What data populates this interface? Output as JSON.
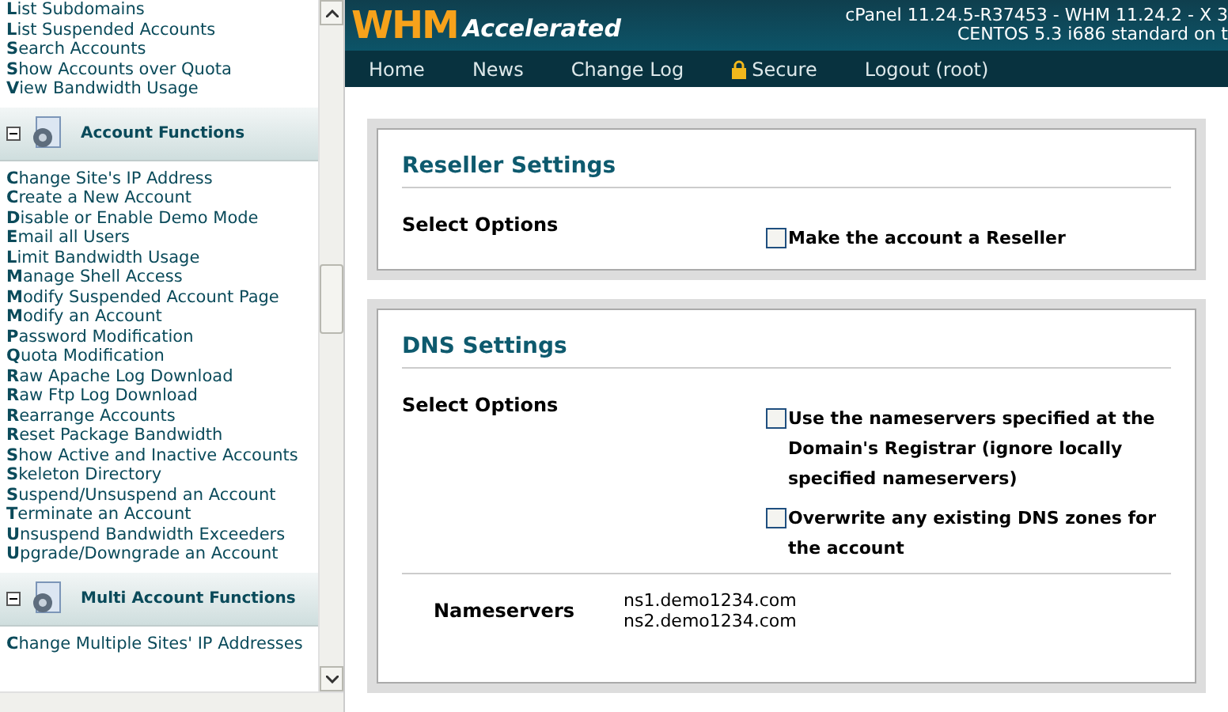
{
  "sidebar": {
    "groups": [
      {
        "links": [
          "**L**ist Subdomains",
          "**L**ist Suspended Accounts",
          "**S**earch Accounts",
          "**S**how Accounts over Quota",
          "**V**iew Bandwidth Usage"
        ]
      },
      {
        "title": "Account Functions",
        "expanded": true,
        "links": [
          "**C**hange Site's IP Address",
          "**C**reate a New Account",
          "**D**isable or Enable Demo Mode",
          "**E**mail all Users",
          "**L**imit Bandwidth Usage",
          "**M**anage Shell Access",
          "**M**odify Suspended Account Page",
          "**M**odify an Account",
          "**P**assword Modification",
          "**Q**uota Modification",
          "**R**aw Apache Log Download",
          "**R**aw Ftp Log Download",
          "**R**earrange Accounts",
          "**R**eset Package Bandwidth",
          "**S**how Active and Inactive Accounts",
          "**S**keleton Directory",
          "**S**uspend/Unsuspend an Account",
          "**T**erminate an Account",
          "**U**nsuspend Bandwidth Exceeders",
          "**U**pgrade/Downgrade an Account"
        ]
      },
      {
        "title": "Multi Account Functions",
        "expanded": true,
        "links": [
          "**C**hange Multiple Sites' IP Addresses"
        ]
      }
    ]
  },
  "header": {
    "logo": "WHM",
    "logo_tagline": "Accelerated",
    "version_lines": [
      "cPanel 11.24.5-R37453 - WHM 11.24.2 - X 3",
      "CENTOS 5.3 i686 standard on t"
    ]
  },
  "nav": [
    {
      "label": "Home",
      "kind": "link"
    },
    {
      "label": "News",
      "kind": "link"
    },
    {
      "label": "Change Log",
      "kind": "link"
    },
    {
      "label": "Secure",
      "kind": "lock"
    },
    {
      "label": "Logout (root)",
      "kind": "link"
    }
  ],
  "panels": [
    {
      "title": "Reseller Settings",
      "option_label": "Select Options",
      "options": [
        {
          "label": "Make the account a Reseller",
          "checked": false
        }
      ]
    },
    {
      "title": "DNS Settings",
      "option_label": "Select Options",
      "options": [
        {
          "label": "Use the nameservers specified at the Domain's Registrar (ignore locally specified nameservers)",
          "checked": false
        },
        {
          "label": "Overwrite any existing DNS zones for the account",
          "checked": false
        }
      ],
      "nameservers": {
        "label": "Nameservers",
        "values": [
          "ns1.demo1234.com",
          "ns2.demo1234.com"
        ]
      }
    }
  ]
}
